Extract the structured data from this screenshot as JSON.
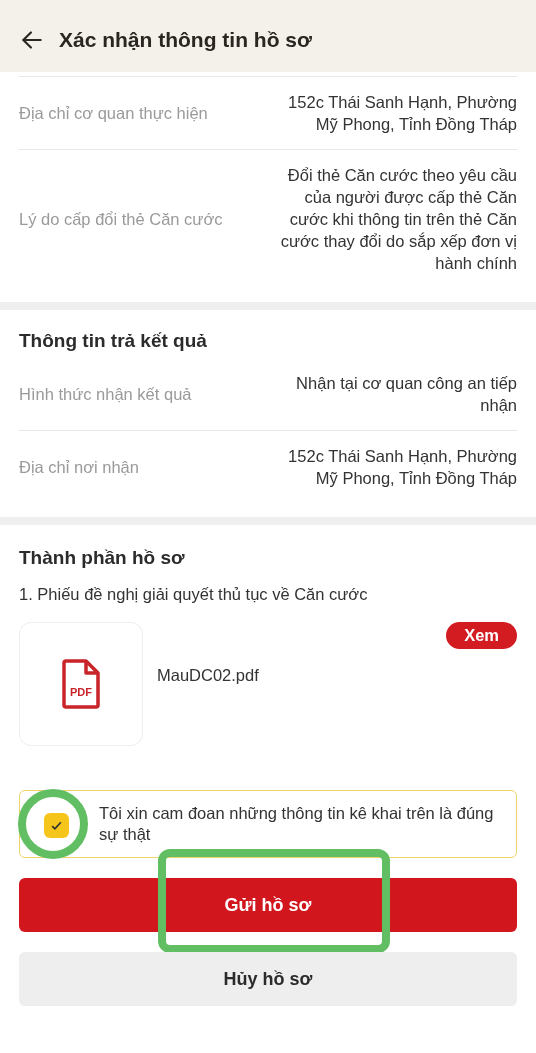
{
  "header": {
    "title": "Xác nhận thông tin hồ sơ"
  },
  "sections": [
    {
      "rows": [
        {
          "label": "Địa chỉ cơ quan thực hiện",
          "value": "152c Thái Sanh Hạnh, Phường Mỹ Phong, Tỉnh Đồng Tháp"
        },
        {
          "label": "Lý do cấp đổi thẻ Căn cước",
          "value": "Đổi thẻ Căn cước theo yêu cầu của người được cấp thẻ Căn cước khi thông tin trên thẻ Căn cước thay đổi do sắp xếp đơn vị hành chính"
        }
      ]
    },
    {
      "title": "Thông tin trả kết quả",
      "rows": [
        {
          "label": "Hình thức nhận kết quả",
          "value": "Nhận tại cơ quan công an tiếp nhận"
        },
        {
          "label": "Địa chỉ nơi nhận",
          "value": "152c Thái Sanh Hạnh, Phường Mỹ Phong, Tỉnh Đồng Tháp"
        }
      ]
    }
  ],
  "documents": {
    "title": "Thành phần hồ sơ",
    "items": [
      {
        "name": "1. Phiếu đề nghị giải quyết thủ tục về Căn cước",
        "file": "MauDC02.pdf",
        "file_type": "PDF",
        "action": "Xem"
      }
    ]
  },
  "pledge": {
    "text": "Tôi xin cam đoan những thông tin kê khai trên là đúng sự thật",
    "checked": true,
    "highlighted": true
  },
  "buttons": [
    {
      "label": "Gửi hồ sơ",
      "kind": "primary",
      "highlighted": true
    },
    {
      "label": "Hủy hồ sơ",
      "kind": "secondary",
      "highlighted": false
    }
  ]
}
